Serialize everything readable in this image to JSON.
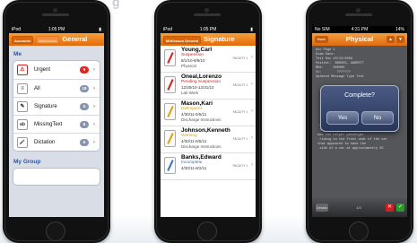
{
  "phones": [
    {
      "status": {
        "carrier": "iPod",
        "time": "1:05 PM",
        "battery": "▮"
      },
      "nav": {
        "back_label": "Accounts",
        "mid_label": "McKesson",
        "title": "General"
      },
      "section_me": "Me",
      "rows": [
        {
          "label": "Urgent",
          "icon": "alert-icon",
          "glyph": "⚠",
          "count": "9",
          "badge_color": "#e4221e"
        },
        {
          "label": "All",
          "icon": "list-icon",
          "glyph": "≡",
          "count": "18"
        },
        {
          "label": "Signature",
          "icon": "pen-icon",
          "glyph": "✎",
          "count": "5"
        },
        {
          "label": "MissingText",
          "icon": "text-field-icon",
          "glyph": "ab",
          "count": "6"
        },
        {
          "label": "Dictation",
          "icon": "microphone-icon",
          "glyph": "🎤",
          "count": "6"
        }
      ],
      "section_group": "My Group"
    },
    {
      "status": {
        "carrier": "iPod",
        "time": "1:05 PM",
        "battery": "▮"
      },
      "nav": {
        "back_label": "McKesson General",
        "title": "Signature"
      },
      "items": [
        {
          "name": "Young,Carl",
          "status": "Suspension",
          "status_color": "#d02020",
          "dates": "8/1/10-8/9/10",
          "facility": "FACILITY 1",
          "desc": "Physical",
          "pen": "r"
        },
        {
          "name": "Oneal,Lorenzo",
          "status": "Pending Suspension",
          "status_color": "#d02020",
          "dates": "12/30/10-12/31/10",
          "facility": "FACILITY 1",
          "desc": "Lab Work",
          "pen": "r"
        },
        {
          "name": "Mason,Kari",
          "status": "Delinquent",
          "status_color": "#e0a000",
          "dates": "4/30/11-5/5/11",
          "facility": "FACILITY 1",
          "desc": "Discharge Instructions",
          "pen": "o"
        },
        {
          "name": "Johnson,Kenneth",
          "status": "Warning",
          "status_color": "#e0a000",
          "dates": "4/30/11-5/5/11",
          "facility": "FACILITY 1",
          "desc": "Discharge Instructions",
          "pen": "o"
        },
        {
          "name": "Banks,Edward",
          "status": "Incomplete",
          "status_color": "#3a70c0",
          "dates": "4/30/11-8/2/11",
          "facility": "FACILITY 1",
          "desc": "",
          "pen": "b"
        }
      ]
    },
    {
      "status": {
        "carrier": "No SIM",
        "time": "4:31 PM",
        "battery": "14%"
      },
      "nav": {
        "back_label": "Back",
        "title": "Physical",
        "prev": "▲",
        "next": "▼"
      },
      "document_text": "Acc Page 1\nExam Date:\nTest Doc 10/13/2009\nPatient:  BROOKS, GARRETT\nMR#:     000000\nCo:        ???????\nUpdated Message Type Test\n\n\n\n\n\n\n\n\n\n\n  CHOW HISTORY:\n  The patient tells me that he ___ to\n was the helper passenger\n  riding in the front seat of the car\n that appeared to have the\n  side of a car at approximately 35",
      "alert": {
        "title": "Complete?",
        "yes": "Yes",
        "no": "No"
      },
      "toolbar": {
        "details": "Details",
        "page": "1/3",
        "reject": "✕",
        "accept": "✓"
      }
    }
  ]
}
